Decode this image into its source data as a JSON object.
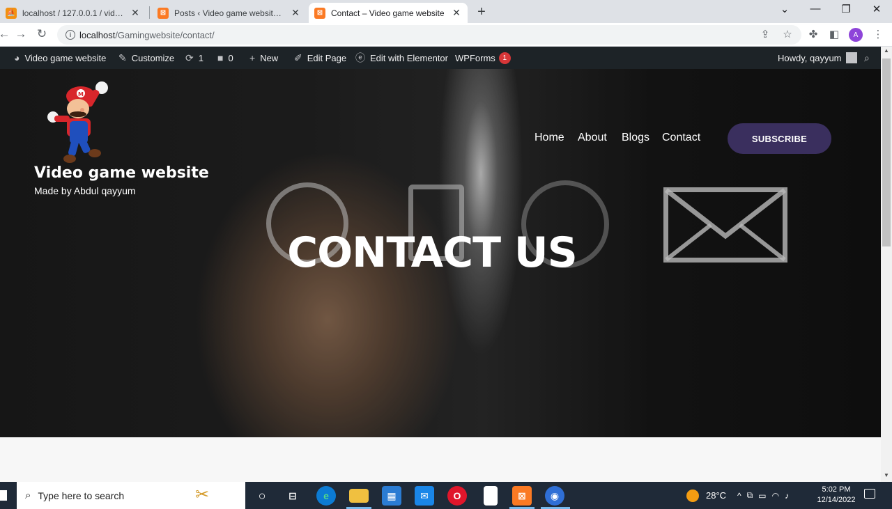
{
  "browser": {
    "tabs": [
      {
        "title": "localhost / 127.0.0.1 / videogame",
        "favicon": "phpmyadmin-icon",
        "active": false
      },
      {
        "title": "Posts ‹ Video game website — W",
        "favicon": "xampp-icon",
        "active": false
      },
      {
        "title": "Contact – Video game website",
        "favicon": "xampp-icon",
        "active": true
      }
    ],
    "url_host": "localhost",
    "url_path": "/Gamingwebsite/contact/"
  },
  "adminbar": {
    "site_name": "Video game website",
    "customize": "Customize",
    "updates_count": "1",
    "comments_count": "0",
    "new_label": "New",
    "edit_page": "Edit Page",
    "elementor": "Edit with Elementor",
    "wpforms": "WPForms",
    "wpforms_badge": "1",
    "howdy": "Howdy, qayyum"
  },
  "site": {
    "title": "Video game website",
    "tagline": "Made by Abdul qayyum",
    "nav": [
      "Home",
      "About",
      "Blogs",
      "Contact"
    ],
    "subscribe": "SUBSCRIBE",
    "hero_heading": "CONTACT US",
    "accent_color": "#3a2f5e"
  },
  "taskbar": {
    "search_placeholder": "Type here to search",
    "weather": "28°C",
    "time": "5:02 PM",
    "date": "12/14/2022"
  }
}
